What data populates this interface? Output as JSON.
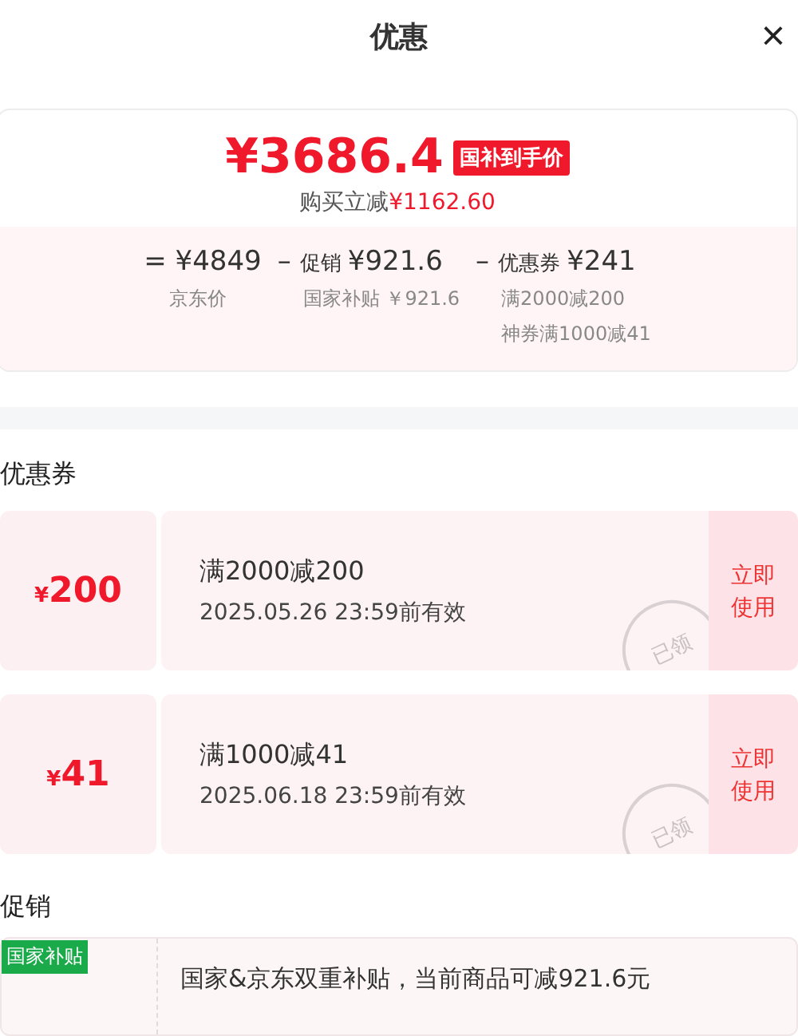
{
  "header": {
    "title": "优惠",
    "close": "×"
  },
  "price_card": {
    "price_symbol": "¥",
    "price": "3686.4",
    "badge": "国补到手价",
    "saving_label": "购买立减",
    "saving_value": "¥1162.60",
    "breakdown": [
      {
        "op": "=",
        "value": "¥4849",
        "notes": [
          "京东价"
        ]
      },
      {
        "op": "–",
        "label": "促销",
        "value": "¥921.6",
        "notes": [
          "国家补贴 ￥921.6"
        ]
      },
      {
        "op": "–",
        "label": "优惠券",
        "value": "¥241",
        "notes": [
          "满2000减200",
          "神券满1000减41"
        ]
      }
    ]
  },
  "coupons_section": {
    "title": "优惠券",
    "coupons": [
      {
        "symbol": "¥",
        "amount": "200",
        "condition": "满2000减200",
        "validity": "2025.05.26 23:59前有效",
        "stamp": "已领",
        "claimed": true,
        "action": "立即使用"
      },
      {
        "symbol": "¥",
        "amount": "41",
        "condition": "满1000减41",
        "validity": "2025.06.18 23:59前有效",
        "stamp": "已领",
        "claimed": true,
        "action": "立即使用"
      }
    ]
  },
  "promo_section": {
    "title": "促销",
    "promos": [
      {
        "tag": "国家补贴",
        "color": "#1aaa4a",
        "text": "国家&京东双重补贴，当前商品可减921.6元"
      }
    ]
  }
}
